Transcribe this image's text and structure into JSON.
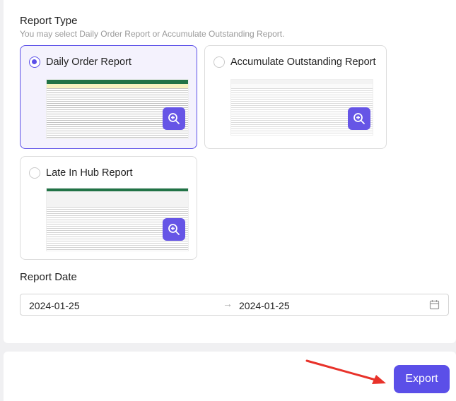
{
  "report_type": {
    "title": "Report Type",
    "hint": "You may select Daily Order Report or Accumulate Outstanding Report.",
    "options": [
      {
        "label": "Daily Order Report",
        "selected": true
      },
      {
        "label": "Accumulate Outstanding Report",
        "selected": false
      },
      {
        "label": "Late In Hub Report",
        "selected": false
      }
    ]
  },
  "report_date": {
    "label": "Report Date",
    "start": "2024-01-25",
    "separator": "→",
    "end": "2024-01-25"
  },
  "footer": {
    "export_label": "Export"
  },
  "colors": {
    "accent": "#5b4fe8",
    "zoom_button": "#6655e6",
    "arrow": "#e8322a"
  }
}
